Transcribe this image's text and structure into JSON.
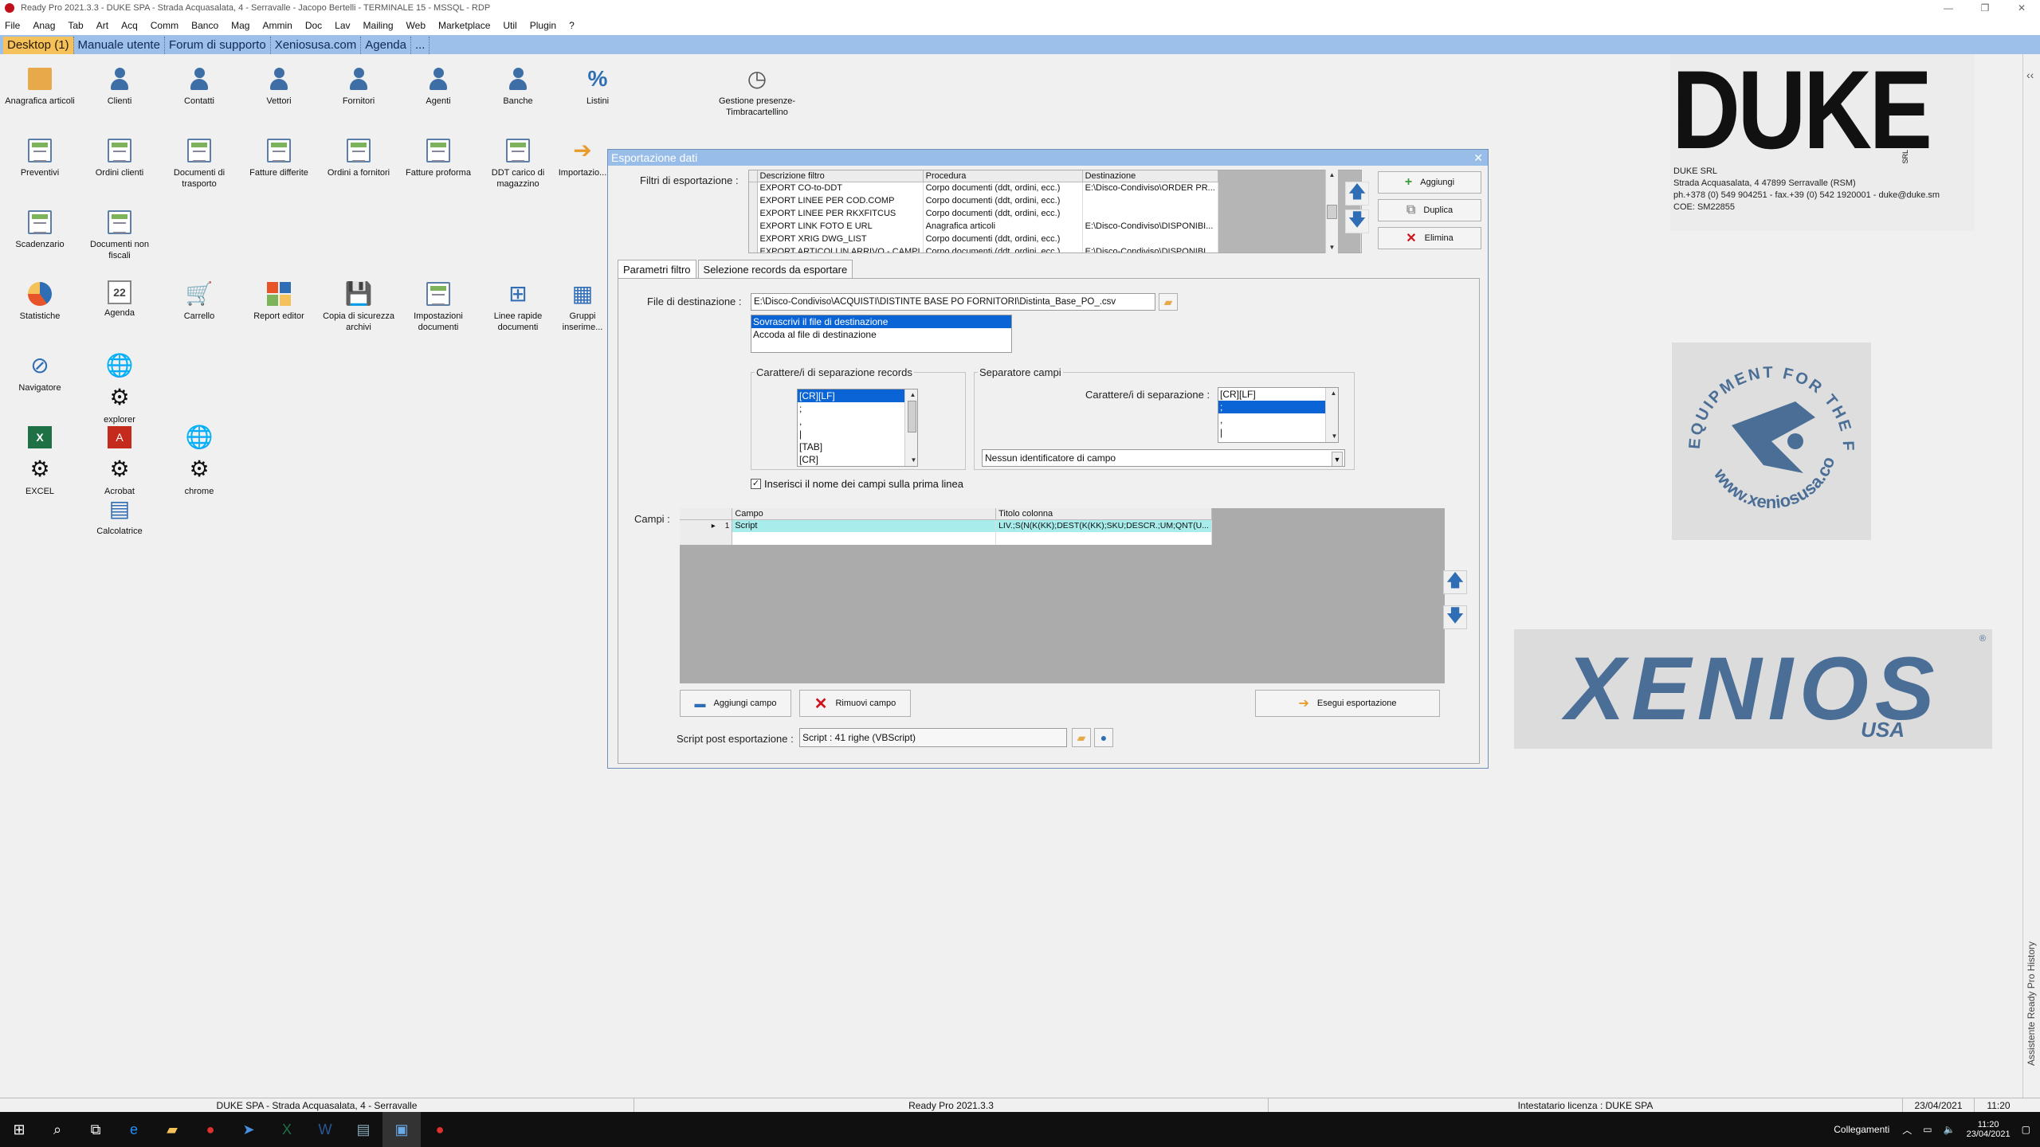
{
  "window": {
    "title": "Ready Pro 2021.3.3 - DUKE SPA - Strada Acquasalata, 4 - Serravalle - Jacopo Bertelli - TERMINALE 15 - MSSQL - RDP"
  },
  "menu": [
    "File",
    "Anag",
    "Tab",
    "Art",
    "Acq",
    "Comm",
    "Banco",
    "Mag",
    "Ammin",
    "Doc",
    "Lav",
    "Mailing",
    "Web",
    "Marketplace",
    "Util",
    "Plugin",
    "?"
  ],
  "tabs": [
    {
      "label": "Desktop (1)",
      "active": true
    },
    {
      "label": "Manuale utente"
    },
    {
      "label": "Forum di supporto"
    },
    {
      "label": "Xeniosusa.com"
    },
    {
      "label": "Agenda"
    },
    {
      "label": "..."
    }
  ],
  "desktop_icons": [
    {
      "label": "Anagrafica articoli",
      "icon": "box-icon"
    },
    {
      "label": "Clienti",
      "icon": "person-icon"
    },
    {
      "label": "Contatti",
      "icon": "person-icon"
    },
    {
      "label": "Vettori",
      "icon": "person-icon"
    },
    {
      "label": "Fornitori",
      "icon": "person-icon"
    },
    {
      "label": "Agenti",
      "icon": "person-icon"
    },
    {
      "label": "Banche",
      "icon": "person-icon"
    },
    {
      "label": "Listini",
      "icon": "percent-icon"
    },
    {
      "label": "Gestione presenze-Timbracartellino",
      "icon": "clock-icon"
    },
    {
      "label": "Preventivi",
      "icon": "doc-icon"
    },
    {
      "label": "Ordini clienti",
      "icon": "doc-icon"
    },
    {
      "label": "Documenti di trasporto",
      "icon": "doc-icon"
    },
    {
      "label": "Fatture differite",
      "icon": "doc-icon"
    },
    {
      "label": "Ordini a fornitori",
      "icon": "doc-icon"
    },
    {
      "label": "Fatture proforma",
      "icon": "doc-icon"
    },
    {
      "label": "DDT carico di magazzino",
      "icon": "doc-icon"
    },
    {
      "label": "Importazio...",
      "icon": "import-icon"
    },
    {
      "label": "Scadenzario",
      "icon": "doc-icon"
    },
    {
      "label": "Documenti non fiscali",
      "icon": "doc-icon"
    },
    {
      "label": "Statistiche",
      "icon": "pie-icon"
    },
    {
      "label": "Agenda",
      "icon": "calendar-icon"
    },
    {
      "label": "Carrello",
      "icon": "cart-icon"
    },
    {
      "label": "Report editor",
      "icon": "report-icon"
    },
    {
      "label": "Copia di sicurezza archivi",
      "icon": "backup-icon"
    },
    {
      "label": "Impostazioni documenti",
      "icon": "settings-doc-icon"
    },
    {
      "label": "Linee rapide documenti",
      "icon": "tree-icon"
    },
    {
      "label": "Gruppi inserime...",
      "icon": "grid-icon"
    },
    {
      "label": "Navigatore",
      "icon": "compass-icon"
    },
    {
      "label": "explorer",
      "icon": "globe-icon"
    },
    {
      "label": "EXCEL",
      "icon": "excel-icon"
    },
    {
      "label": "Acrobat",
      "icon": "acrobat-icon"
    },
    {
      "label": "chrome",
      "icon": "globe-icon"
    },
    {
      "label": "Calcolatrice",
      "icon": "calculator-icon"
    }
  ],
  "duke": {
    "logo": "DUKE",
    "srl": "SRL",
    "lines": [
      "DUKE SRL",
      "Strada Acquasalata, 4 47899 Serravalle (RSM)",
      "ph.+378 (0) 549 904251 - fax.+39 (0) 542 1920001 - duke@duke.sm",
      "COE: SM22855"
    ]
  },
  "seal": {
    "top": "EQUIPMENT FOR THE FITTEST",
    "bottom": "www.xeniosusa.com"
  },
  "xenios": {
    "word": "XENIOS",
    "usa": "USA",
    "reg": "®"
  },
  "dialog": {
    "title": "Esportazione dati",
    "filters_label": "Filtri di esportazione :",
    "filter_columns": [
      "Descrizione filtro",
      "Procedura",
      "Destinazione"
    ],
    "filter_rows": [
      [
        "EXPORT CO-to-DDT",
        "Corpo documenti (ddt, ordini, ecc.)",
        "E:\\Disco-Condiviso\\ORDER PR..."
      ],
      [
        "EXPORT LINEE PER COD.COMP",
        "Corpo documenti (ddt, ordini, ecc.)",
        ""
      ],
      [
        "EXPORT LINEE PER RKXFITCUS",
        "Corpo documenti (ddt, ordini, ecc.)",
        ""
      ],
      [
        "EXPORT LINK FOTO E URL",
        "Anagrafica articoli",
        "E:\\Disco-Condiviso\\DISPONIBI..."
      ],
      [
        "EXPORT XRIG DWG_LIST",
        "Corpo documenti (ddt, ordini, ecc.)",
        ""
      ],
      [
        "EXPORT ARTICOLI IN ARRIVO - CAMPI",
        "Corpo documenti (ddt, ordini, ecc.)",
        "E:\\Disco-Condiviso\\DISPONIBI..."
      ]
    ],
    "buttons": {
      "add": "Aggiungi",
      "dup": "Duplica",
      "del": "Elimina"
    },
    "tabs": [
      "Parametri filtro",
      "Selezione records da esportare"
    ],
    "dest_label": "File di destinazione :",
    "dest_value": "E:\\Disco-Condiviso\\ACQUISTI\\DISTINTE BASE PO FORNITORI\\Distinta_Base_PO_.csv",
    "dest_options": [
      "Sovrascrivi il file di destinazione",
      "Accoda al file di destinazione"
    ],
    "rec_sep_legend": "Carattere/i di separazione records",
    "rec_sep_items": [
      "[CR][LF]",
      ";",
      ",",
      "|",
      "[TAB]",
      "[CR]"
    ],
    "field_sep_legend": "Separatore campi",
    "field_sep_label": "Carattere/i di separazione :",
    "field_sep_items": [
      "[CR][LF]",
      ";",
      ",",
      "|"
    ],
    "field_id": "Nessun identificatore di campo",
    "header_check": "Inserisci il nome dei campi sulla prima linea",
    "fields_label": "Campi :",
    "fields_columns": [
      "Campo",
      "Titolo colonna"
    ],
    "fields_rows": [
      [
        "1",
        "Script",
        "LIV.;S(N(K(KK);DEST(K(KK);SKU;DESCR.;UM;QNT(U..."
      ]
    ],
    "add_field": "Aggiungi campo",
    "remove_field": "Rimuovi campo",
    "run_export": "Esegui esportazione",
    "script_label": "Script post esportazione :",
    "script_value": "Script : 41 righe (VBScript)"
  },
  "side": {
    "chevron": "‹‹",
    "text": "Assistente Ready Pro   History"
  },
  "status": {
    "company": "DUKE SPA - Strada Acquasalata, 4 - Serravalle",
    "version": "Ready Pro 2021.3.3",
    "license": "Intestatario licenza : DUKE SPA",
    "date": "23/04/2021",
    "time": "11:20"
  },
  "taskbar": {
    "tray_label": "Collegamenti",
    "time": "11:20",
    "date": "23/04/2021"
  }
}
